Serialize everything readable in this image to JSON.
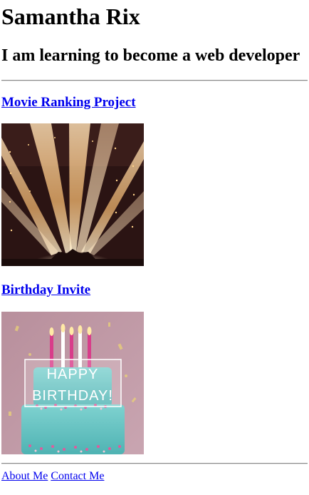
{
  "header": {
    "name": "Samantha Rix",
    "tagline": "I am learning to become a web developer"
  },
  "projects": [
    {
      "title": "Movie Ranking Project",
      "image_icon": "stage-spotlights-image"
    },
    {
      "title": "Birthday Invite",
      "image_icon": "birthday-cake-image",
      "image_text_line1": "HAPPY",
      "image_text_line2": "BIRTHDAY!"
    }
  ],
  "footer": {
    "about_label": "About Me",
    "contact_label": "Contact Me"
  },
  "colors": {
    "link": "#0000ee",
    "text": "#000000",
    "background": "#ffffff"
  }
}
